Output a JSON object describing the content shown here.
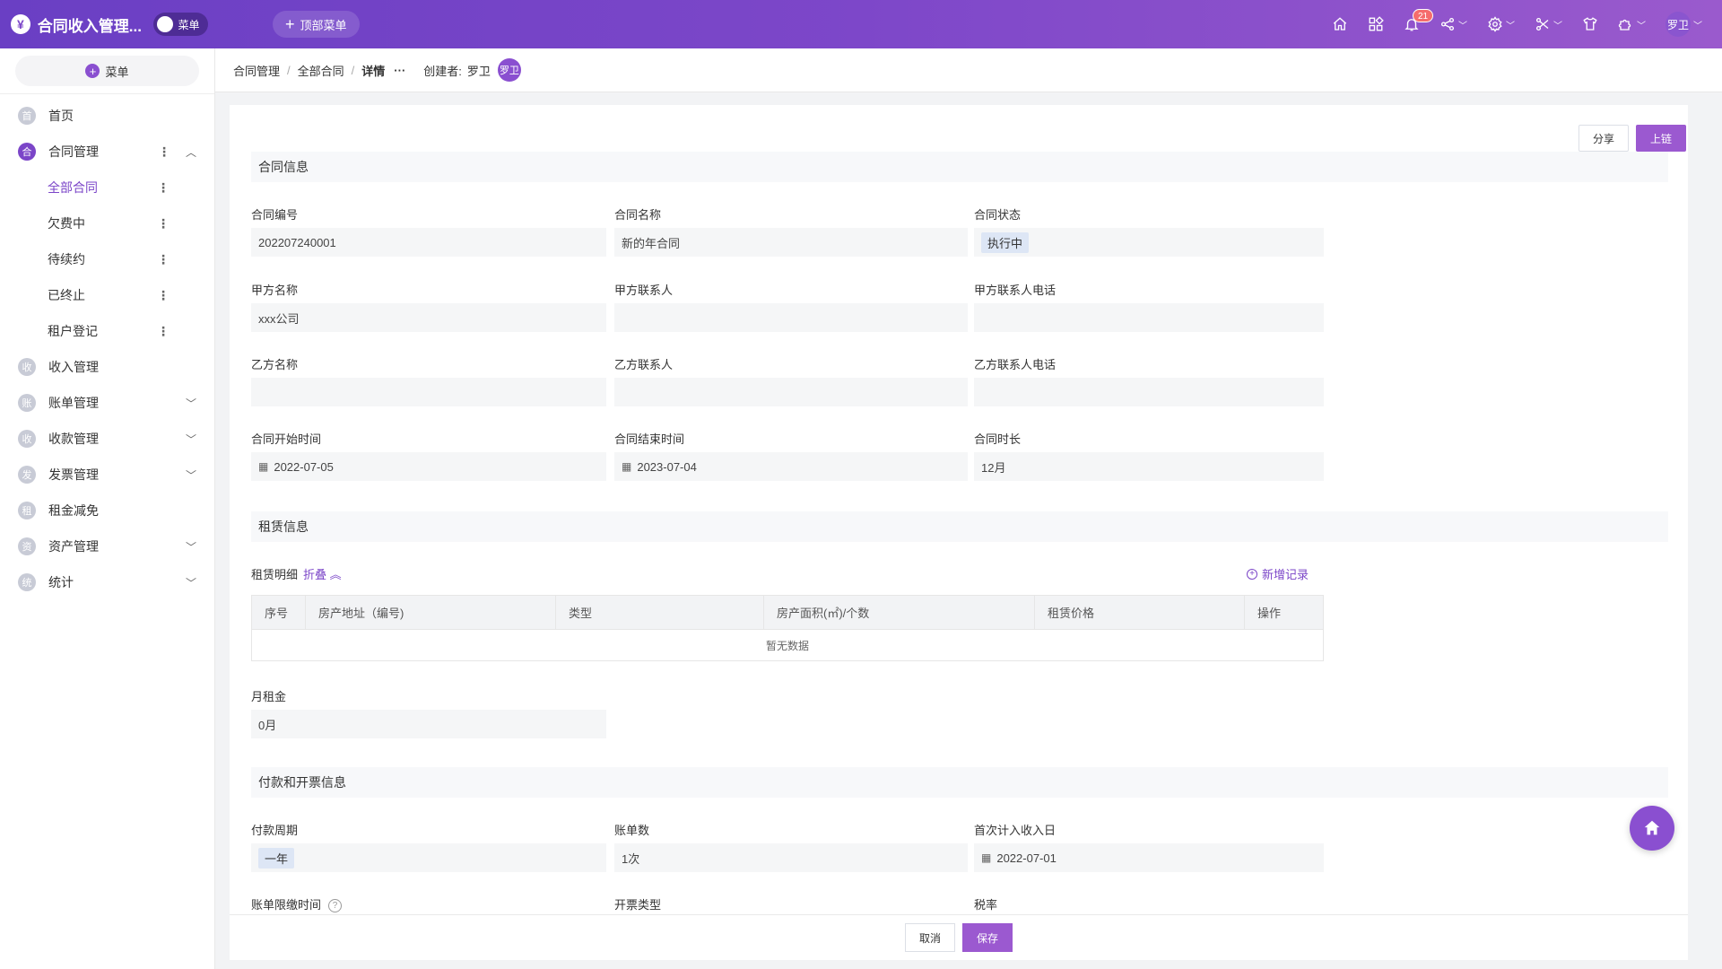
{
  "app": {
    "logo": "¥",
    "title": "合同收入管理...",
    "menu_toggle_label": "菜单",
    "top_menu_label": "顶部菜单"
  },
  "topbar_icons": {
    "notification_count": "21",
    "user_name": "罗卫"
  },
  "sidebar": {
    "menu_btn_label": "菜单",
    "items": [
      {
        "icon": "首",
        "label": "首页"
      },
      {
        "icon": "合",
        "label": "合同管理"
      },
      {
        "icon": "收",
        "label": "收入管理"
      },
      {
        "icon": "账",
        "label": "账单管理"
      },
      {
        "icon": "收",
        "label": "收款管理"
      },
      {
        "icon": "发",
        "label": "发票管理"
      },
      {
        "icon": "租",
        "label": "租金减免"
      },
      {
        "icon": "资",
        "label": "资产管理"
      },
      {
        "icon": "统",
        "label": "统计"
      }
    ],
    "sub_items": [
      {
        "label": "全部合同"
      },
      {
        "label": "欠费中"
      },
      {
        "label": "待续约"
      },
      {
        "label": "已终止"
      },
      {
        "label": "租户登记"
      }
    ]
  },
  "breadcrumb": {
    "items": [
      "合同管理",
      "全部合同",
      "详情"
    ],
    "more": "···",
    "creator_label": "创建者:",
    "creator_name": "罗卫",
    "creator_avatar": "罗卫"
  },
  "actions": {
    "share": "分享",
    "chain": "上链",
    "cancel": "取消",
    "save": "保存"
  },
  "sections": {
    "contract_info": "合同信息",
    "lease_info": "租赁信息",
    "payment_info": "付款和开票信息"
  },
  "fields": {
    "contract_no": {
      "label": "合同编号",
      "value": "202207240001"
    },
    "contract_name": {
      "label": "合同名称",
      "value": "新的年合同"
    },
    "contract_status": {
      "label": "合同状态",
      "value": "执行中"
    },
    "party_a_name": {
      "label": "甲方名称",
      "value": "xxx公司"
    },
    "party_a_contact": {
      "label": "甲方联系人",
      "value": ""
    },
    "party_a_phone": {
      "label": "甲方联系人电话",
      "value": ""
    },
    "party_b_name": {
      "label": "乙方名称",
      "value": ""
    },
    "party_b_contact": {
      "label": "乙方联系人",
      "value": ""
    },
    "party_b_phone": {
      "label": "乙方联系人电话",
      "value": ""
    },
    "start_date": {
      "label": "合同开始时间",
      "value": "2022-07-05"
    },
    "end_date": {
      "label": "合同结束时间",
      "value": "2023-07-04"
    },
    "duration": {
      "label": "合同时长",
      "value": "12月"
    },
    "monthly_rent": {
      "label": "月租金",
      "value": "0月"
    },
    "pay_cycle": {
      "label": "付款周期",
      "value": "一年"
    },
    "bill_count": {
      "label": "账单数",
      "value": "1次"
    },
    "first_income_date": {
      "label": "首次计入收入日",
      "value": "2022-07-01"
    },
    "bill_deadline": {
      "label": "账单限缴时间"
    },
    "invoice_type": {
      "label": "开票类型"
    },
    "tax_rate": {
      "label": "税率"
    }
  },
  "lease_table": {
    "title": "租赁明细",
    "fold_label": "折叠",
    "add_label": "新增记录",
    "columns": [
      "序号",
      "房产地址（编号)",
      "类型",
      "房产面积(㎡)/个数",
      "租赁价格",
      "操作"
    ],
    "empty_text": "暂无数据"
  }
}
